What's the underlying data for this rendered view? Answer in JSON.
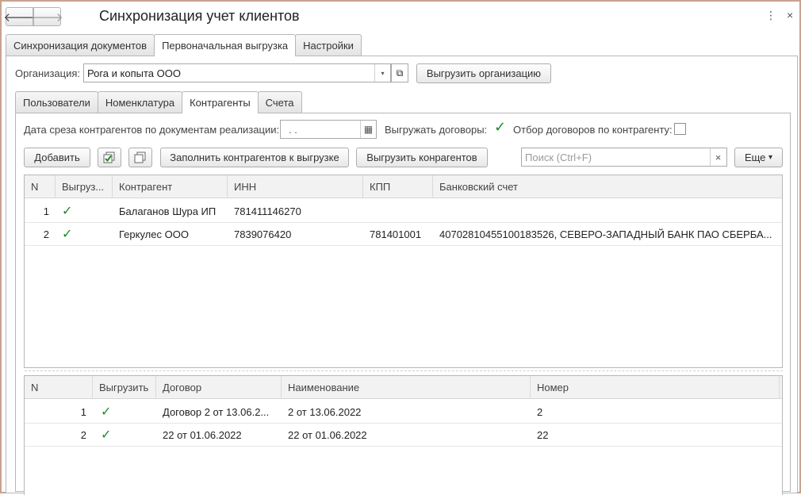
{
  "window": {
    "title": "Синхронизация учет клиентов",
    "back_glyph": "🡐",
    "forward_glyph": "🡒",
    "menu_glyph": "⋮",
    "close_glyph": "×"
  },
  "main_tabs": [
    {
      "label": "Синхронизация документов",
      "active": false
    },
    {
      "label": "Первоначальная выгрузка",
      "active": true
    },
    {
      "label": "Настройки",
      "active": false
    }
  ],
  "organization": {
    "label": "Организация:",
    "value": "Рога и копыта ООО",
    "export_button": "Выгрузить организацию"
  },
  "inner_tabs": [
    {
      "label": "Пользователи",
      "active": false
    },
    {
      "label": "Номенклатура",
      "active": false
    },
    {
      "label": "Контрагенты",
      "active": true
    },
    {
      "label": "Счета",
      "active": false
    }
  ],
  "filters": {
    "date_label": "Дата среза контрагентов по документам реализации:",
    "date_value": " .  .",
    "export_contracts_label": "Выгружать договоры:",
    "export_contracts_checked": true,
    "filter_label": "Отбор договоров по контрагенту:",
    "filter_checked": false
  },
  "toolbar": {
    "add_label": "Добавить",
    "fill_label": "Заполнить контрагентов к выгрузке",
    "export_label": "Выгрузить конрагентов",
    "search_placeholder": "Поиск (Ctrl+F)",
    "search_clear": "×",
    "more_label": "Еще",
    "more_arrow": "▾"
  },
  "counterparties_table": {
    "columns": [
      "N",
      "Выгруз...",
      "Контрагент",
      "ИНН",
      "КПП",
      "Банковский счет"
    ],
    "rows": [
      {
        "n": "1",
        "export": true,
        "name": "Балаганов Шура ИП",
        "inn": "781411146270",
        "kpp": "",
        "account": ""
      },
      {
        "n": "2",
        "export": true,
        "name": "Геркулес ООО",
        "inn": "7839076420",
        "kpp": "781401001",
        "account": "40702810455100183526, СЕВЕРО-ЗАПАДНЫЙ БАНК ПАО СБЕРБА..."
      }
    ]
  },
  "contracts_table": {
    "columns": [
      "N",
      "Выгрузить",
      "Договор",
      "Наименование",
      "Номер"
    ],
    "rows": [
      {
        "n": "1",
        "export": true,
        "contract": "Договор 2 от 13.06.2...",
        "name": "2 от 13.06.2022",
        "number": "2"
      },
      {
        "n": "2",
        "export": true,
        "contract": "22 от 01.06.2022",
        "name": "22 от 01.06.2022",
        "number": "22"
      }
    ]
  },
  "check_glyph": "✓",
  "calendar_glyph": "▦",
  "dropdown_glyph": "▾",
  "open_glyph": "⧉"
}
